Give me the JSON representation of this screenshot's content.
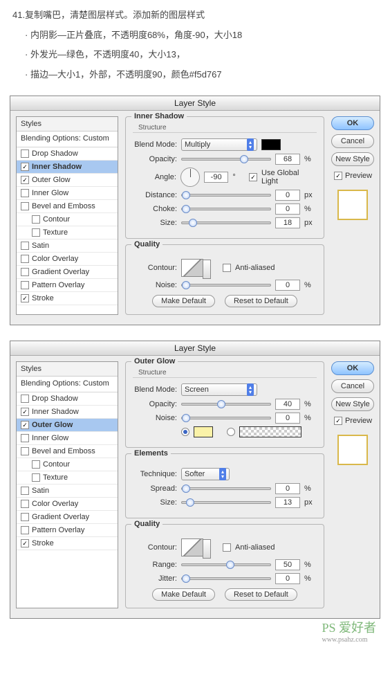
{
  "tutorial": {
    "step_num": "41.",
    "step_text": "复制嘴巴，清楚图层样式。添加新的图层样式",
    "bullets": [
      "· 内阴影—正片叠底，不透明度68%，角度-90，大小18",
      "· 外发光—绿色，不透明度40，大小13，",
      "· 描边—大小1，外部，不透明度90，颜色#f5d767"
    ]
  },
  "ui": {
    "dialog_title": "Layer Style",
    "styles_header": "Styles",
    "blending_opts": "Blending Options: Custom",
    "style_list": [
      {
        "label": "Drop Shadow",
        "checked": false
      },
      {
        "label": "Inner Shadow",
        "checked": true
      },
      {
        "label": "Outer Glow",
        "checked": true
      },
      {
        "label": "Inner Glow",
        "checked": false
      },
      {
        "label": "Bevel and Emboss",
        "checked": false
      },
      {
        "label": "Contour",
        "checked": false,
        "indent": true
      },
      {
        "label": "Texture",
        "checked": false,
        "indent": true
      },
      {
        "label": "Satin",
        "checked": false
      },
      {
        "label": "Color Overlay",
        "checked": false
      },
      {
        "label": "Gradient Overlay",
        "checked": false
      },
      {
        "label": "Pattern Overlay",
        "checked": false
      },
      {
        "label": "Stroke",
        "checked": true
      }
    ],
    "labels": {
      "blend_mode": "Blend Mode:",
      "opacity": "Opacity:",
      "angle": "Angle:",
      "use_global": "Use Global Light",
      "distance": "Distance:",
      "choke": "Choke:",
      "size": "Size:",
      "noise": "Noise:",
      "contour": "Contour:",
      "anti_aliased": "Anti-aliased",
      "technique": "Technique:",
      "spread": "Spread:",
      "range": "Range:",
      "jitter": "Jitter:",
      "pct": "%",
      "px": "px",
      "deg": "°"
    },
    "sections": {
      "inner_shadow": "Inner Shadow",
      "outer_glow": "Outer Glow",
      "structure": "Structure",
      "elements": "Elements",
      "quality": "Quality"
    },
    "buttons": {
      "ok": "OK",
      "cancel": "Cancel",
      "new_style": "New Style",
      "preview": "Preview",
      "make_default": "Make Default",
      "reset": "Reset to Default"
    },
    "values_panel1": {
      "blend_mode": "Multiply",
      "opacity": "68",
      "angle": "-90",
      "distance": "0",
      "choke": "0",
      "size": "18",
      "noise": "0"
    },
    "values_panel2": {
      "blend_mode": "Screen",
      "technique": "Softer",
      "opacity": "40",
      "noise": "0",
      "spread": "0",
      "size": "13",
      "range": "50",
      "jitter": "0"
    }
  },
  "watermark": {
    "main": "PS 爱好者",
    "sub": "www.psahz.com"
  }
}
